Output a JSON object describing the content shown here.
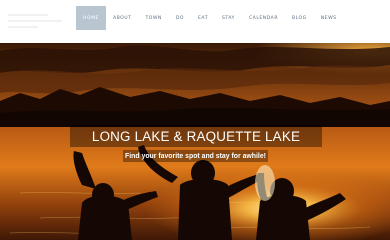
{
  "nav": {
    "items": [
      {
        "label": "HOME",
        "active": true
      },
      {
        "label": "ABOUT",
        "active": false
      },
      {
        "label": "TOWN",
        "active": false
      },
      {
        "label": "DO",
        "active": false
      },
      {
        "label": "EAT",
        "active": false
      },
      {
        "label": "STAY",
        "active": false
      },
      {
        "label": "CALENDAR",
        "active": false
      },
      {
        "label": "BLOG",
        "active": false
      },
      {
        "label": "NEWS",
        "active": false
      }
    ]
  },
  "hero": {
    "title": "LONG LAKE & RAQUETTE LAKE",
    "subtitle": "Find your favorite spot and stay for awhile!"
  },
  "colors": {
    "nav_text": "#5e6f80",
    "nav_active_bg": "#b9c6d2",
    "sunset_orange": "#f28a1a"
  }
}
